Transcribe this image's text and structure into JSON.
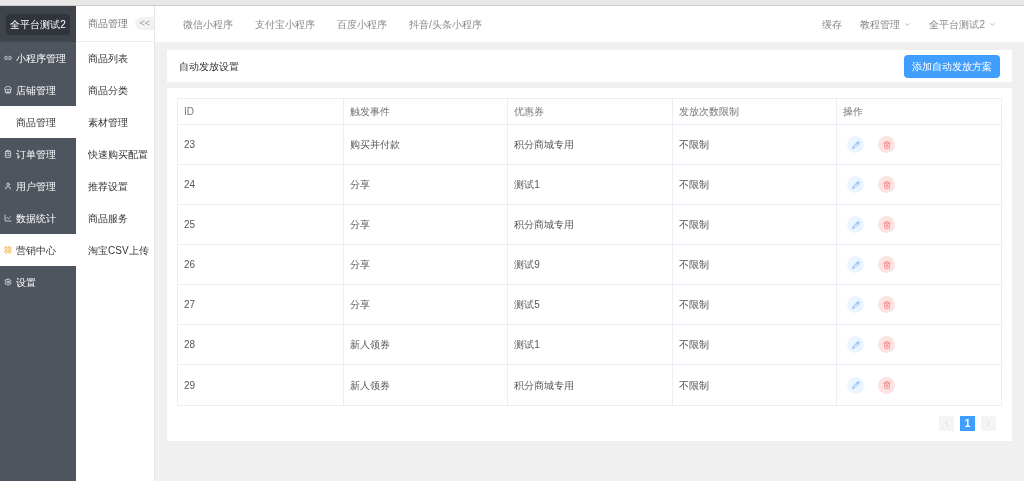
{
  "brand": "全平台测试2",
  "sidebar": {
    "items": [
      {
        "label": "小程序管理",
        "kind": "link",
        "selected": false
      },
      {
        "label": "店铺管理",
        "kind": "shop",
        "selected": false
      },
      {
        "label": "商品管理",
        "kind": "sub",
        "selected": true
      },
      {
        "label": "订单管理",
        "kind": "order",
        "selected": false
      },
      {
        "label": "用户管理",
        "kind": "user",
        "selected": false
      },
      {
        "label": "数据统计",
        "kind": "chart",
        "selected": false
      },
      {
        "label": "营销中心",
        "kind": "marketing",
        "selected": true
      },
      {
        "label": "设置",
        "kind": "settings",
        "selected": false
      }
    ]
  },
  "submenu": {
    "title": "商品管理",
    "collapse": "<<",
    "items": [
      "商品列表",
      "商品分类",
      "素材管理",
      "快速购买配置",
      "推荐设置",
      "商品服务",
      "淘宝CSV上传"
    ]
  },
  "top_tabs": [
    "微信小程序",
    "支付宝小程序",
    "百度小程序",
    "抖音/头条小程序"
  ],
  "top_right": [
    {
      "label": "缓存",
      "dropdown": false
    },
    {
      "label": "教程管理",
      "dropdown": true
    },
    {
      "label": "全平台测试2",
      "dropdown": true
    }
  ],
  "panel": {
    "title": "自动发放设置",
    "button": "添加自动发放方案"
  },
  "table": {
    "columns": [
      "ID",
      "触发事件",
      "优惠券",
      "发放次数限制",
      "操作"
    ],
    "rows": [
      [
        "23",
        "购买并付款",
        "积分商城专用",
        "不限制"
      ],
      [
        "24",
        "分享",
        "测试1",
        "不限制"
      ],
      [
        "25",
        "分享",
        "积分商城专用",
        "不限制"
      ],
      [
        "26",
        "分享",
        "测试9",
        "不限制"
      ],
      [
        "27",
        "分享",
        "测试5",
        "不限制"
      ],
      [
        "28",
        "新人领券",
        "测试1",
        "不限制"
      ],
      [
        "29",
        "新人领券",
        "积分商城专用",
        "不限制"
      ]
    ]
  },
  "pagination": {
    "pages": [
      {
        "label": "1",
        "selected": true
      }
    ]
  }
}
